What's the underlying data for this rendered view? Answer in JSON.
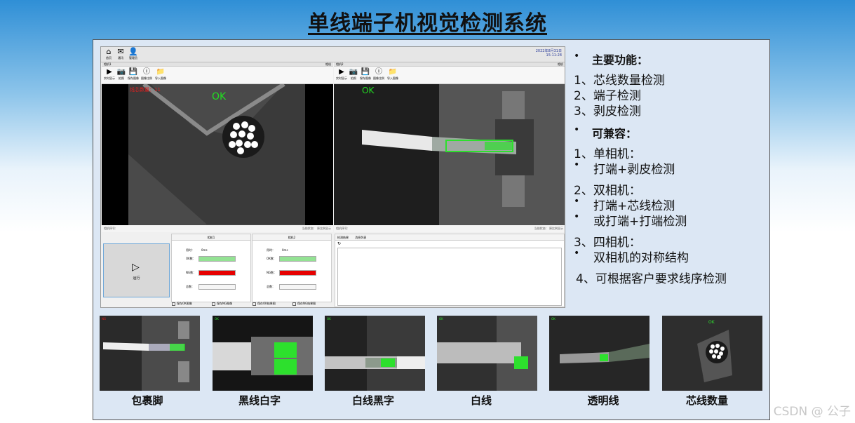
{
  "title": "单线端子机视觉检测系统",
  "app": {
    "toolbar": {
      "home": "首页",
      "mail": "通讯",
      "admin": "管理员"
    },
    "datetime": [
      "2022年8月31日",
      "15:11:28"
    ],
    "camera1": {
      "name": "相机1",
      "right": "相机",
      "tools": [
        "实时显示",
        "拍照",
        "保存图像",
        "图像比例",
        "导入图像"
      ],
      "overlay_count": "线芯数量：11",
      "result": "OK",
      "foot_left": "相机序号:",
      "foot_right": "当前状态：   原比例显示"
    },
    "camera2": {
      "name": "相机2",
      "right": "相机",
      "tools": [
        "实时显示",
        "拍照",
        "保存图像",
        "图像比例",
        "导入图像"
      ],
      "result": "OK",
      "foot_left": "相机序号:",
      "foot_right": "当前状态：   原比例显示"
    },
    "run_label": "运行",
    "stats1": {
      "header": "相机1",
      "time_label": "用时：",
      "time_value": "0ms",
      "ok_label": "OK数：",
      "ng_label": "NG数：",
      "total_label": "总数："
    },
    "stats2": {
      "header": "相机2",
      "time_label": "用时：",
      "time_value": "0ms",
      "ok_label": "OK数：",
      "ng_label": "NG数：",
      "total_label": "总数："
    },
    "checks": [
      "保存OK图像",
      "保存NG图像",
      "保存OK结果图",
      "保存NG结果图"
    ],
    "log_tabs": [
      "检测结果",
      "消息列表"
    ],
    "refresh_icon": "refresh-icon"
  },
  "features": {
    "main_title": "主要功能：",
    "main_items": [
      "1、芯线数量检测",
      "2、端子检测",
      "3、剥皮检测"
    ],
    "compat_title": "可兼容：",
    "single": "1、单相机：",
    "single_items": [
      "打端+剥皮检测"
    ],
    "double": "2、双相机：",
    "double_items": [
      "打端+芯线检测",
      "或打端+打端检测"
    ],
    "quad": "3、四相机：",
    "quad_items": [
      "双相机的对称结构"
    ],
    "custom": "4、可根据客户要求线序检测"
  },
  "thumbs": [
    {
      "caption": "包裹脚",
      "mark": "NG",
      "mark_color": "#e02020"
    },
    {
      "caption": "黑线白字",
      "mark": "OK",
      "mark_color": "#30e030"
    },
    {
      "caption": "白线黑字",
      "mark": "OK",
      "mark_color": "#30e030"
    },
    {
      "caption": "白线",
      "mark": "OK",
      "mark_color": "#30e030"
    },
    {
      "caption": "透明线",
      "mark": "OK",
      "mark_color": "#30e030"
    },
    {
      "caption": "芯线数量",
      "mark": "OK",
      "mark_color": "#30e030"
    }
  ],
  "colors": {
    "ok_bar": "#93e293",
    "ng_bar": "#e60000",
    "ok_text": "#22dd22",
    "ng_text": "#ff2020"
  },
  "watermark": "CSDN @ 公子"
}
